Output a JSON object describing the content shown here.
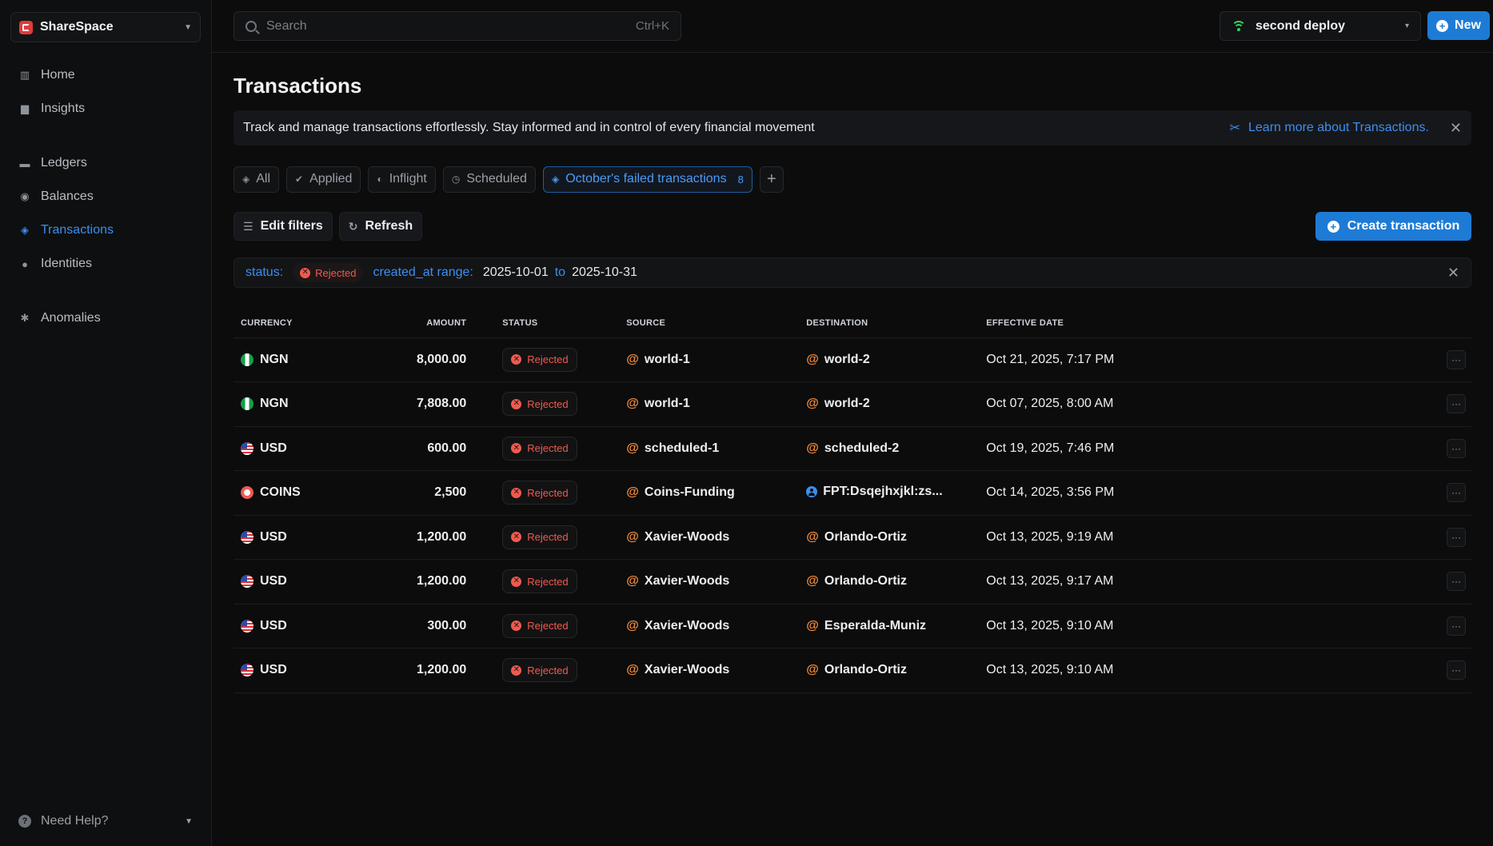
{
  "workspace": {
    "name": "ShareSpace"
  },
  "sidebar": {
    "groups": [
      [
        {
          "label": "Home",
          "icon": "home-icon"
        },
        {
          "label": "Insights",
          "icon": "chart-icon"
        }
      ],
      [
        {
          "label": "Ledgers",
          "icon": "folder-icon"
        },
        {
          "label": "Balances",
          "icon": "coins-icon"
        },
        {
          "label": "Transactions",
          "icon": "transactions-icon",
          "active": true
        },
        {
          "label": "Identities",
          "icon": "users-icon"
        }
      ],
      [
        {
          "label": "Anomalies",
          "icon": "bug-icon"
        }
      ]
    ],
    "help_label": "Need Help?"
  },
  "topbar": {
    "search_placeholder": "Search",
    "search_shortcut": "Ctrl+K",
    "deploy_name": "second deploy",
    "new_label": "New"
  },
  "page": {
    "title": "Transactions",
    "banner_text": "Track and manage transactions effortlessly. Stay informed and in control of every financial movement",
    "banner_link": "Learn more about Transactions."
  },
  "tabs": [
    {
      "label": "All",
      "icon": "layers-icon"
    },
    {
      "label": "Applied",
      "icon": "check-circle-icon"
    },
    {
      "label": "Inflight",
      "icon": "half-circle-icon"
    },
    {
      "label": "Scheduled",
      "icon": "clock-icon"
    },
    {
      "label": "October's failed transactions",
      "icon": "layers-icon",
      "count": "8",
      "active": true
    }
  ],
  "actions": {
    "edit_filters": "Edit filters",
    "refresh": "Refresh",
    "create": "Create transaction"
  },
  "filters": {
    "status_key": "status:",
    "status_value": "Rejected",
    "range_key": "created_at range:",
    "range_from": "2025-10-01",
    "range_to_word": "to",
    "range_to": "2025-10-31"
  },
  "table": {
    "headers": [
      "CURRENCY",
      "AMOUNT",
      "STATUS",
      "SOURCE",
      "DESTINATION",
      "EFFECTIVE DATE"
    ],
    "rows": [
      {
        "currency": "NGN",
        "flag": "ngn",
        "amount": "8,000.00",
        "status": "Rejected",
        "source": "world-1",
        "destination": "world-2",
        "dest_type": "at",
        "date": "Oct 21, 2025, 7:17 PM"
      },
      {
        "currency": "NGN",
        "flag": "ngn",
        "amount": "7,808.00",
        "status": "Rejected",
        "source": "world-1",
        "destination": "world-2",
        "dest_type": "at",
        "date": "Oct 07, 2025, 8:00 AM"
      },
      {
        "currency": "USD",
        "flag": "usd",
        "amount": "600.00",
        "status": "Rejected",
        "source": "scheduled-1",
        "destination": "scheduled-2",
        "dest_type": "at",
        "date": "Oct 19, 2025, 7:46 PM"
      },
      {
        "currency": "COINS",
        "flag": "coins",
        "amount": "2,500",
        "status": "Rejected",
        "source": "Coins-Funding",
        "destination": "FPT:Dsqejhxjkl:zs...",
        "dest_type": "user",
        "date": "Oct 14, 2025, 3:56 PM"
      },
      {
        "currency": "USD",
        "flag": "usd",
        "amount": "1,200.00",
        "status": "Rejected",
        "source": "Xavier-Woods",
        "destination": "Orlando-Ortiz",
        "dest_type": "at",
        "date": "Oct 13, 2025, 9:19 AM"
      },
      {
        "currency": "USD",
        "flag": "usd",
        "amount": "1,200.00",
        "status": "Rejected",
        "source": "Xavier-Woods",
        "destination": "Orlando-Ortiz",
        "dest_type": "at",
        "date": "Oct 13, 2025, 9:17 AM"
      },
      {
        "currency": "USD",
        "flag": "usd",
        "amount": "300.00",
        "status": "Rejected",
        "source": "Xavier-Woods",
        "destination": "Esperalda-Muniz",
        "dest_type": "at",
        "date": "Oct 13, 2025, 9:10 AM"
      },
      {
        "currency": "USD",
        "flag": "usd",
        "amount": "1,200.00",
        "status": "Rejected",
        "source": "Xavier-Woods",
        "destination": "Orlando-Ortiz",
        "dest_type": "at",
        "date": "Oct 13, 2025, 9:10 AM"
      }
    ]
  },
  "colors": {
    "accent": "#1d7bd6",
    "link": "#3b8ff2",
    "rejected": "#f05a4f",
    "account_at": "#f08a3c",
    "online": "#2fd35e"
  }
}
